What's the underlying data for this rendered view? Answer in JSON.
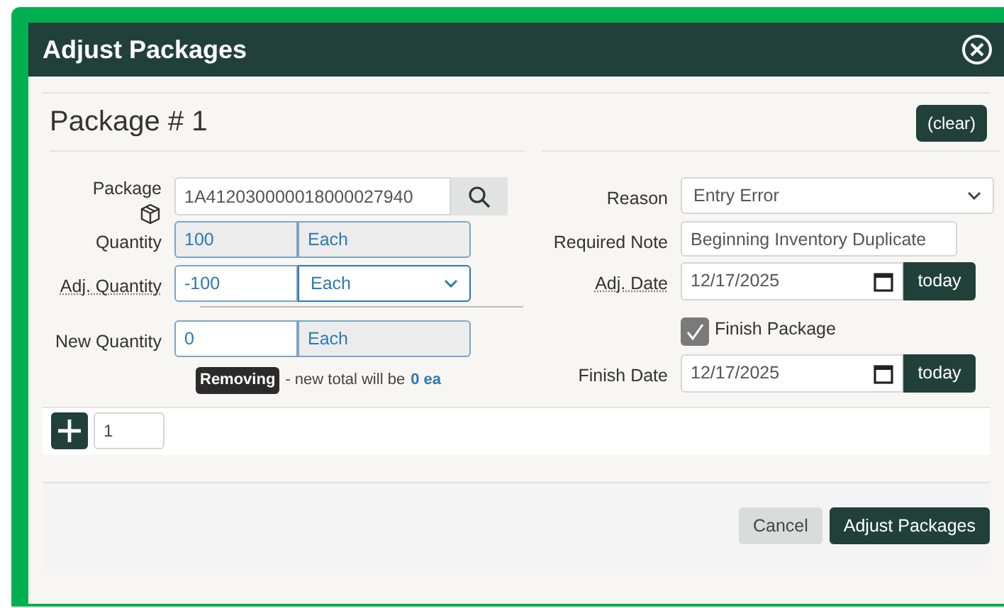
{
  "window": {
    "title": "Adjust Packages"
  },
  "package": {
    "heading": "Package # 1",
    "clear_button": "(clear)",
    "left": {
      "package_label": "Package",
      "package_value": "1A412030000018000027940",
      "quantity_label": "Quantity",
      "quantity_value": "100",
      "quantity_unit": "Each",
      "adj_quantity_label": "Adj. Quantity",
      "adj_quantity_value": "-100",
      "adj_quantity_unit": "Each",
      "new_quantity_label": "New Quantity",
      "new_quantity_value": "0",
      "new_quantity_unit": "Each",
      "status_badge": "Removing",
      "status_message": "- new total will be",
      "status_total": "0 ea"
    },
    "right": {
      "reason_label": "Reason",
      "reason_value": "Entry Error",
      "note_label": "Required Note",
      "note_value": "Beginning Inventory Duplicate",
      "adj_date_label": "Adj. Date",
      "adj_date_value": "12/17/2025",
      "adj_date_button": "today",
      "finish_package": {
        "label": "Finish Package",
        "checked": true
      },
      "finish_date_label": "Finish Date",
      "finish_date_value": "12/17/2025",
      "finish_date_button": "today"
    }
  },
  "add_row": {
    "count_value": "1"
  },
  "buttons": [
    {
      "label": "Cancel",
      "kind": "secondary"
    },
    {
      "label": "Adjust Packages",
      "kind": "primary"
    }
  ]
}
